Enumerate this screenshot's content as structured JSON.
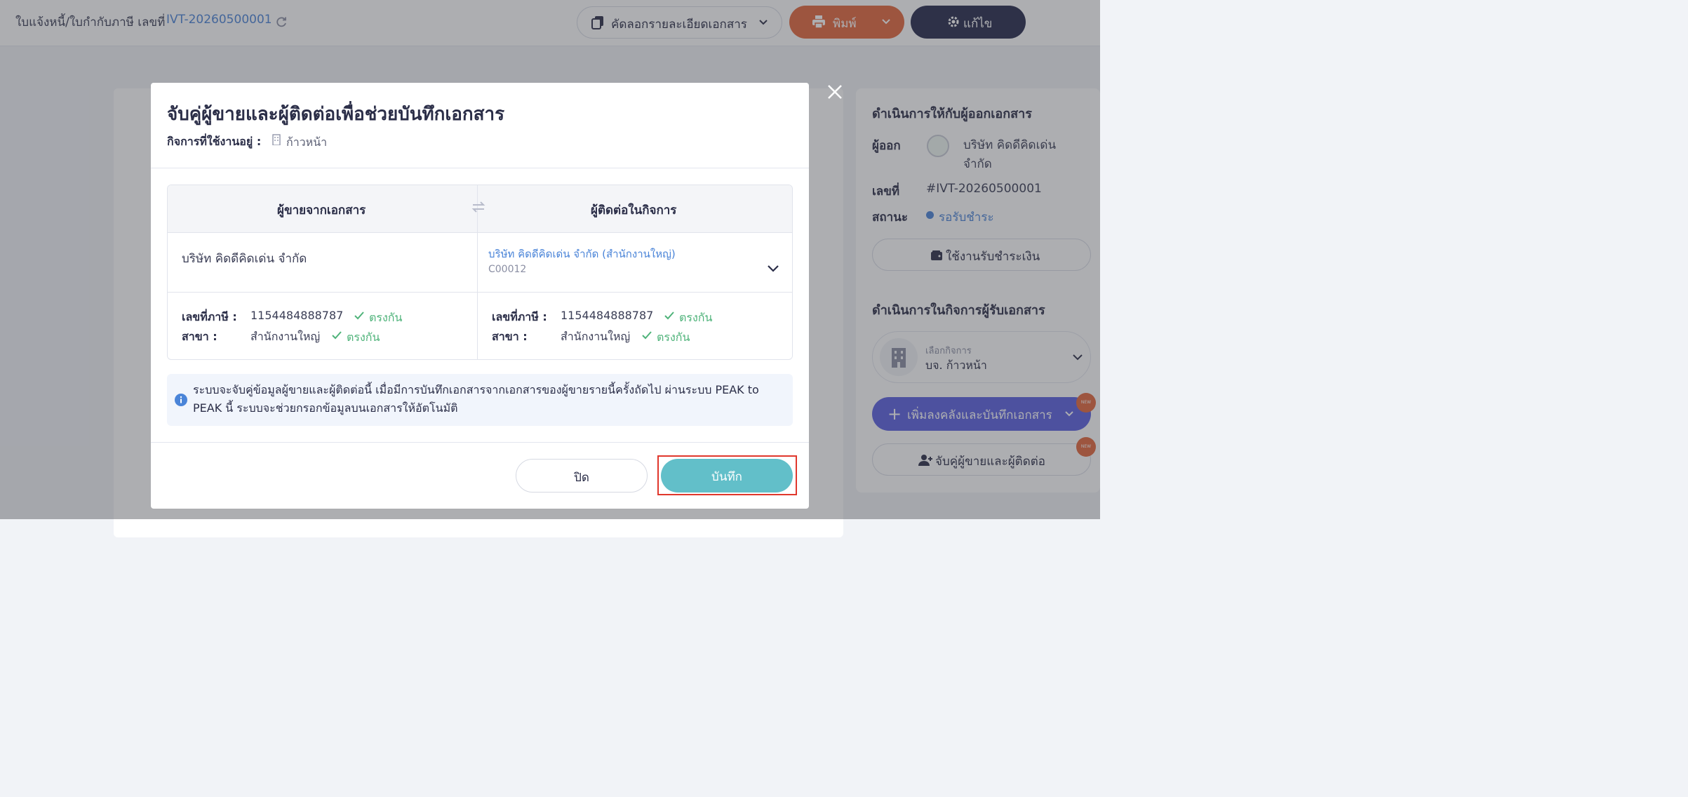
{
  "header": {
    "doc_title": "ใบแจ้งหนี้/ใบกำกับภาษี เลขที่",
    "doc_number": "IVT-20260500001",
    "copy_button": "คัดลอกรายละเอียดเอกสาร",
    "print_button": "พิมพ์",
    "edit_button": "แก้ไข"
  },
  "side_panel": {
    "section1_title": "ดำเนินการให้กับผู้ออกเอกสาร",
    "issuer_label": "ผู้ออก",
    "issuer_name_line1": "บริษัท คิดดีคิดเด่น",
    "issuer_name_line2": "จำกัด",
    "number_label": "เลขที่",
    "number_value": "#IVT-20260500001",
    "status_label": "สถานะ",
    "status_value": "รอรับชำระ",
    "payment_button": "ใช้งานรับชำระเงิน",
    "section2_title": "ดำเนินการในกิจการผู้รับเอกสาร",
    "select_business_label": "เลือกกิจการ",
    "select_business_value": "บจ. ก้าวหน้า",
    "add_button": "เพิ่มลงคลังและบันทึกเอกสาร",
    "match_button": "จับคู่ผู้ขายและผู้ติดต่อ",
    "new_badge": "NEW"
  },
  "modal": {
    "title": "จับคู่ผู้ขายและผู้ติดต่อเพื่อช่วยบันทึกเอกสาร",
    "business_label": "กิจการที่ใช้งานอยู่ :",
    "business_value": "ก้าวหน้า",
    "col_left_header": "ผู้ขายจากเอกสาร",
    "col_right_header": "ผู้ติดต่อในกิจการ",
    "seller_name": "บริษัท คิดดีคิดเด่น จำกัด",
    "contact_name": "บริษัท คิดดีคิดเด่น จำกัด (สำนักงานใหญ่)",
    "contact_code": "C00012",
    "tax_id_label": "เลขที่ภาษี :",
    "branch_label": "สาขา :",
    "left_tax_id": "1154484888787",
    "left_branch": "สำนักงานใหญ่",
    "right_tax_id": "1154484888787",
    "right_branch": "สำนักงานใหญ่",
    "match_text": "ตรงกัน",
    "info_text": "ระบบจะจับคู่ข้อมูลผู้ขายและผู้ติดต่อนี้ เมื่อมีการบันทึกเอกสารจากเอกสารของผู้ขายรายนี้ครั้งถัดไป ผ่านระบบ PEAK to PEAK นี้ ระบบจะช่วยกรอกข้อมูลบนเอกสารให้อัตโนมัติ",
    "close_button": "ปิด",
    "save_button": "บันทึก"
  },
  "colors": {
    "accent_teal": "#62bfc9",
    "print_orange": "#e4673c",
    "edit_navy": "#25284a",
    "primary_purple": "#5b5fe0",
    "link_blue": "#4a84d8",
    "match_green": "#4fb37a",
    "highlight_red": "#e0372c"
  }
}
